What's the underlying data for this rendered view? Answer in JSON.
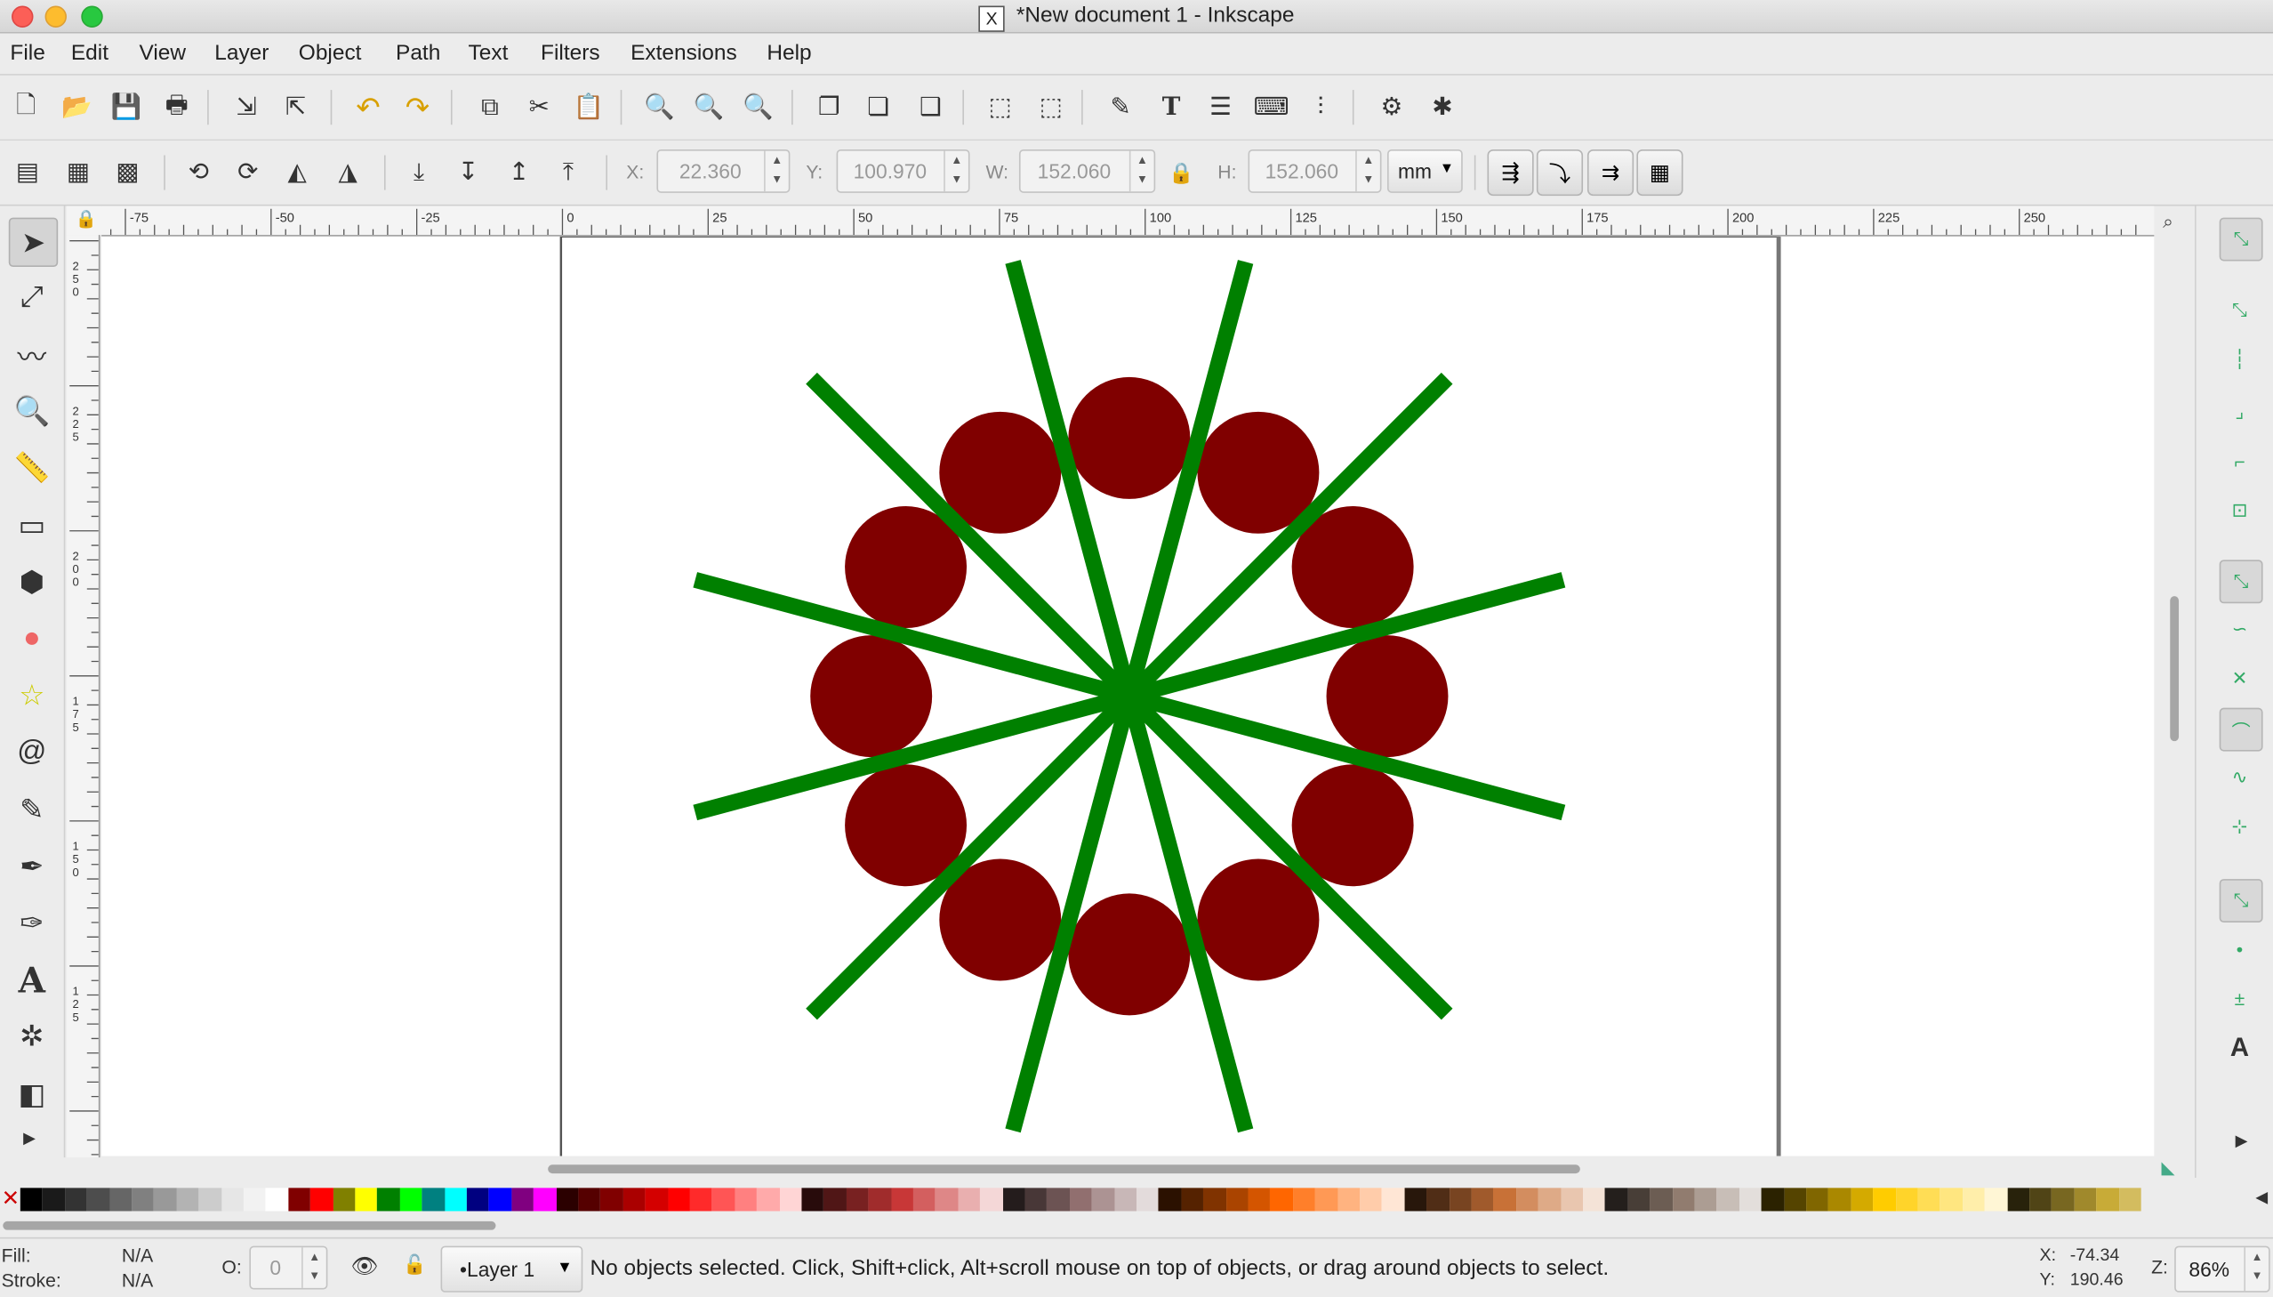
{
  "window": {
    "title": "*New document 1 - Inkscape",
    "app_icon": "x11-icon"
  },
  "menu": [
    "File",
    "Edit",
    "View",
    "Layer",
    "Object",
    "Path",
    "Text",
    "Filters",
    "Extensions",
    "Help"
  ],
  "commands_bar": [
    {
      "name": "new-document-icon",
      "glyph": "🗋"
    },
    {
      "name": "open-icon",
      "glyph": "📂"
    },
    {
      "name": "save-icon",
      "glyph": "💾"
    },
    {
      "name": "print-icon",
      "glyph": "🖶"
    },
    {
      "name": "import-icon",
      "glyph": "⇲"
    },
    {
      "name": "export-icon",
      "glyph": "⇱"
    },
    {
      "name": "undo-icon",
      "glyph": "↶"
    },
    {
      "name": "redo-icon",
      "glyph": "↷"
    },
    {
      "name": "copy-icon",
      "glyph": "⧉"
    },
    {
      "name": "cut-icon",
      "glyph": "✂"
    },
    {
      "name": "paste-icon",
      "glyph": "📋"
    },
    {
      "name": "zoom-selection-icon",
      "glyph": "🔍"
    },
    {
      "name": "zoom-drawing-icon",
      "glyph": "🔍"
    },
    {
      "name": "zoom-page-icon",
      "glyph": "🔍"
    },
    {
      "name": "duplicate-icon",
      "glyph": "❐"
    },
    {
      "name": "clone-icon",
      "glyph": "❏"
    },
    {
      "name": "unlink-clone-icon",
      "glyph": "❑"
    },
    {
      "name": "group-icon",
      "glyph": "⬚"
    },
    {
      "name": "ungroup-icon",
      "glyph": "⬚"
    },
    {
      "name": "fill-stroke-icon",
      "glyph": "✎"
    },
    {
      "name": "text-font-icon",
      "glyph": "T"
    },
    {
      "name": "layers-icon",
      "glyph": "☰"
    },
    {
      "name": "xml-editor-icon",
      "glyph": "⌨"
    },
    {
      "name": "align-distribute-icon",
      "glyph": "⫶"
    },
    {
      "name": "document-properties-icon",
      "glyph": "⚙"
    },
    {
      "name": "preferences-icon",
      "glyph": "✱"
    }
  ],
  "select_toolbar": {
    "x_label": "X:",
    "x_value": "22.360",
    "y_label": "Y:",
    "y_value": "100.970",
    "w_label": "W:",
    "w_value": "152.060",
    "h_label": "H:",
    "h_value": "152.060",
    "unit": "mm"
  },
  "tools": [
    "selector-tool-icon",
    "node-tool-icon",
    "tweak-tool-icon",
    "zoom-tool-icon",
    "measure-tool-icon",
    "rectangle-tool-icon",
    "3d-box-tool-icon",
    "ellipse-tool-icon",
    "star-tool-icon",
    "spiral-tool-icon",
    "pencil-tool-icon",
    "pen-tool-icon",
    "calligraphy-tool-icon",
    "text-tool-icon",
    "spray-tool-icon",
    "eraser-tool-icon"
  ],
  "tool_glyphs": [
    "➤",
    "⤢",
    "〰",
    "🔍",
    "📏",
    "▭",
    "⬢",
    "●",
    "☆",
    "@",
    "✎",
    "✒",
    "✑",
    "A",
    "✲",
    "◧"
  ],
  "ruler": {
    "h_labels": [
      "-75",
      "-50",
      "-25",
      "0",
      "25",
      "50",
      "75",
      "100",
      "125",
      "150",
      "175",
      "200",
      "225",
      "250"
    ],
    "v_labels": [
      "250",
      "225",
      "200",
      "175",
      "150",
      "125"
    ]
  },
  "drawing": {
    "line_color": "#008000",
    "circle_color": "#800000",
    "page_border_color": "#555555"
  },
  "palette_colors": [
    "#000000",
    "#1a1a1a",
    "#333333",
    "#4d4d4d",
    "#666666",
    "#808080",
    "#999999",
    "#b3b3b3",
    "#cccccc",
    "#e6e6e6",
    "#f2f2f2",
    "#ffffff",
    "#800000",
    "#ff0000",
    "#808000",
    "#ffff00",
    "#008000",
    "#00ff00",
    "#008080",
    "#00ffff",
    "#000080",
    "#0000ff",
    "#800080",
    "#ff00ff",
    "#2b0000",
    "#550000",
    "#800000",
    "#aa0000",
    "#d40000",
    "#ff0000",
    "#ff2a2a",
    "#ff5555",
    "#ff8080",
    "#ffaaaa",
    "#ffd5d5",
    "#280b0b",
    "#501616",
    "#782121",
    "#a02c2c",
    "#c83737",
    "#d35f5f",
    "#de8787",
    "#e9afaf",
    "#f4d7d7",
    "#241c1c",
    "#483737",
    "#6c5353",
    "#916f6f",
    "#ac9393",
    "#c8b7b7",
    "#e3dbdb",
    "#2b1100",
    "#552200",
    "#803300",
    "#aa4400",
    "#d45500",
    "#ff6600",
    "#ff7f2a",
    "#ff9955",
    "#ffb380",
    "#ffccaa",
    "#ffe6d5",
    "#28170b",
    "#502d16",
    "#784421",
    "#a05a2c",
    "#c87137",
    "#d38d5f",
    "#deaa87",
    "#e9c6af",
    "#f4e3d7",
    "#241f1c",
    "#483e37",
    "#6c5d53",
    "#917c6f",
    "#ac9d93",
    "#c8beb7",
    "#e3dedb",
    "#2b2200",
    "#554400",
    "#806600",
    "#aa8800",
    "#d4aa00",
    "#ffcc00",
    "#ffd42a",
    "#ffdd55",
    "#ffe680",
    "#ffeeaa",
    "#fff6d5",
    "#28220b",
    "#504416",
    "#786721",
    "#a0892c",
    "#c8ab37",
    "#d3bc5f"
  ],
  "status": {
    "fill_label": "Fill:",
    "fill_value": "N/A",
    "stroke_label": "Stroke:",
    "stroke_value": "N/A",
    "opacity_label": "O:",
    "opacity_value": "0",
    "layer": "•Layer 1",
    "message": "No objects selected. Click, Shift+click, Alt+scroll mouse on top of objects, or drag around objects to select.",
    "x_label": "X:",
    "x_value": "-74.34",
    "y_label": "Y:",
    "y_value": "190.46",
    "zoom_label": "Z:",
    "zoom_value": "86%"
  }
}
